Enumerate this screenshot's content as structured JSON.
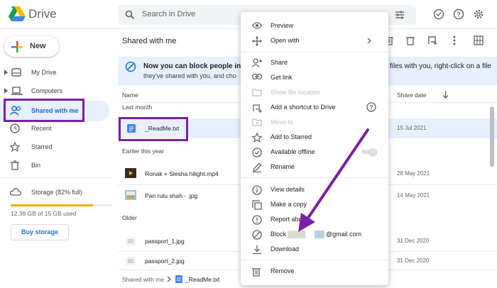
{
  "app": {
    "title": "Drive"
  },
  "search": {
    "placeholder": "Search in Drive"
  },
  "sidebar": {
    "new_label": "New",
    "items": [
      {
        "label": "My Drive"
      },
      {
        "label": "Computers"
      },
      {
        "label": "Shared with me"
      },
      {
        "label": "Recent"
      },
      {
        "label": "Starred"
      },
      {
        "label": "Bin"
      },
      {
        "label": "Storage (82% full)"
      }
    ],
    "storage_used": "12.39 GB of 15 GB used",
    "storage_fraction": 0.82,
    "buy_storage": "Buy storage"
  },
  "main": {
    "title": "Shared with me",
    "banner_line1": "Now you can block people in",
    "banner_line1_end": "files with you, right-click on a file",
    "banner_line2": "they've shared with you, and cho",
    "col_name": "Name",
    "col_share_date": "Share date",
    "sections": [
      "Last month",
      "Earlier this year",
      "Older"
    ],
    "files": [
      {
        "name": "_ReadMe.txt",
        "date": "15 Jul 2021"
      },
      {
        "name": "Ronak + Slesha hilight.mp4",
        "date": "28 May 2021"
      },
      {
        "name": "Pan rutu shah - .jpg",
        "date": "14 May 2021"
      },
      {
        "name": "passport_1.jpg",
        "date": "31 Dec 2020"
      },
      {
        "name": "passport_2.jpg",
        "date": "31 Dec 2020"
      }
    ],
    "breadcrumb_root": "Shared with me",
    "breadcrumb_file": "_ReadMe.txt"
  },
  "menu": {
    "preview": "Preview",
    "open_with": "Open with",
    "share": "Share",
    "get_link": "Get link",
    "show_location": "Show file location",
    "add_shortcut": "Add a shortcut to Drive",
    "move_to": "Move to",
    "add_starred": "Add to Starred",
    "available_offline": "Available offline",
    "rename": "Rename",
    "view_details": "View details",
    "make_copy": "Make a copy",
    "report_abuse": "Report abuse",
    "block": "Block",
    "block_email": "@gmail.com",
    "download": "Download",
    "remove": "Remove"
  },
  "colors": {
    "accent": "#1a73e8",
    "highlight": "#7b1fa2",
    "active_bg": "#e8f0fe"
  }
}
